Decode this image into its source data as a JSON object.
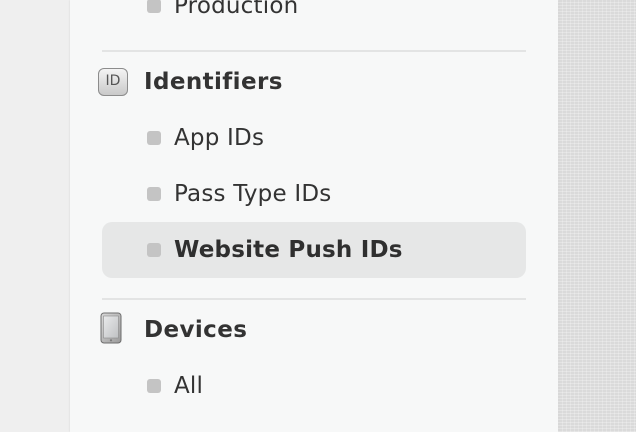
{
  "sidebar": {
    "certificates": {
      "items": [
        {
          "label": "Production"
        }
      ]
    },
    "identifiers": {
      "title": "Identifiers",
      "icon": "id-badge-icon",
      "icon_text": "ID",
      "items": [
        {
          "label": "App IDs",
          "selected": false
        },
        {
          "label": "Pass Type IDs",
          "selected": false
        },
        {
          "label": "Website Push IDs",
          "selected": true
        }
      ]
    },
    "devices": {
      "title": "Devices",
      "icon": "ipad-device-icon",
      "items": [
        {
          "label": "All",
          "selected": false
        }
      ]
    }
  },
  "colors": {
    "sidebar_bg": "#f7f8f8",
    "selected_bg": "#e6e7e7",
    "bullet": "#c4c4c4",
    "text": "#333333"
  }
}
